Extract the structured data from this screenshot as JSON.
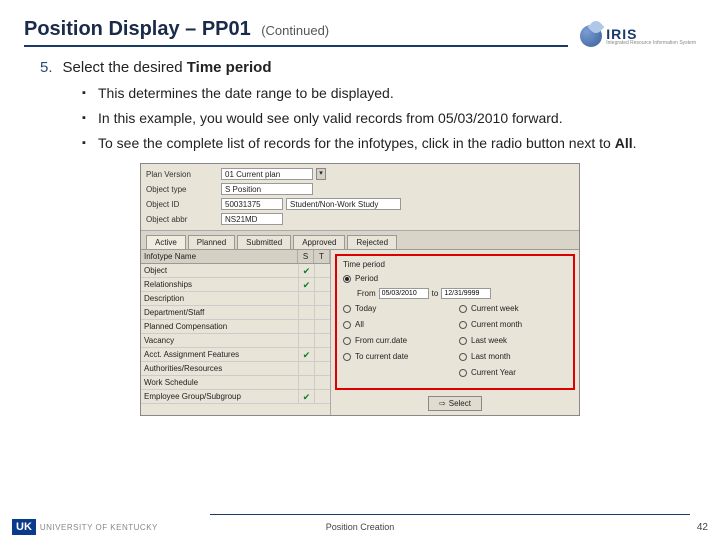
{
  "header": {
    "title": "Position Display – PP01",
    "subtitle": "(Continued)"
  },
  "logo": {
    "main": "IRIS",
    "sub": "Integrated Resource Information System"
  },
  "step": {
    "num": "5.",
    "prefix": "Select the desired ",
    "bold": "Time period"
  },
  "bullets": {
    "b1": "This determines the date range to be displayed.",
    "b2": "In this example, you would see only valid records from 05/03/2010 forward.",
    "b3_a": "To see the complete list of records for the infotypes, click in the radio button next to ",
    "b3_b": "All",
    "b3_c": "."
  },
  "sap": {
    "top": {
      "planVersion": {
        "lbl": "Plan Version",
        "val": "01 Current plan"
      },
      "objType": {
        "lbl": "Object type",
        "val": "S Position"
      },
      "objId": {
        "lbl": "Object ID",
        "val": "50031375",
        "desc": "Student/Non-Work Study"
      },
      "objAbbr": {
        "lbl": "Object abbr",
        "val": "NS21MD"
      }
    },
    "tabs": [
      "Active",
      "Planned",
      "Submitted",
      "Approved",
      "Rejected"
    ],
    "left": {
      "hdr": {
        "c1": "Infotype Name",
        "c2": "S",
        "c3": "T"
      },
      "rows": [
        {
          "name": "Object",
          "s": true,
          "t": false
        },
        {
          "name": "Relationships",
          "s": true,
          "t": false
        },
        {
          "name": "Description",
          "s": false,
          "t": false
        },
        {
          "name": "Department/Staff",
          "s": false,
          "t": false
        },
        {
          "name": "Planned Compensation",
          "s": false,
          "t": false
        },
        {
          "name": "Vacancy",
          "s": false,
          "t": false
        },
        {
          "name": "Acct. Assignment Features",
          "s": true,
          "t": false
        },
        {
          "name": "Authorities/Resources",
          "s": false,
          "t": false
        },
        {
          "name": "Work Schedule",
          "s": false,
          "t": false
        },
        {
          "name": "Employee Group/Subgroup",
          "s": true,
          "t": false
        }
      ]
    },
    "right": {
      "title": "Time period",
      "period": "Period",
      "fromLbl": "From",
      "fromVal": "05/03/2010",
      "toLbl": "to",
      "toVal": "12/31/9999",
      "opts": {
        "today": "Today",
        "all": "All",
        "fromCurr": "From curr.date",
        "toCurr": "To current date",
        "currWeek": "Current week",
        "currMonth": "Current month",
        "lastWeek": "Last week",
        "lastMonth": "Last month",
        "currYear": "Current Year"
      },
      "selectBtn": "Select"
    }
  },
  "footer": {
    "badge": "UK",
    "org": "UNIVERSITY OF KENTUCKY",
    "center": "Position Creation",
    "page": "42"
  }
}
